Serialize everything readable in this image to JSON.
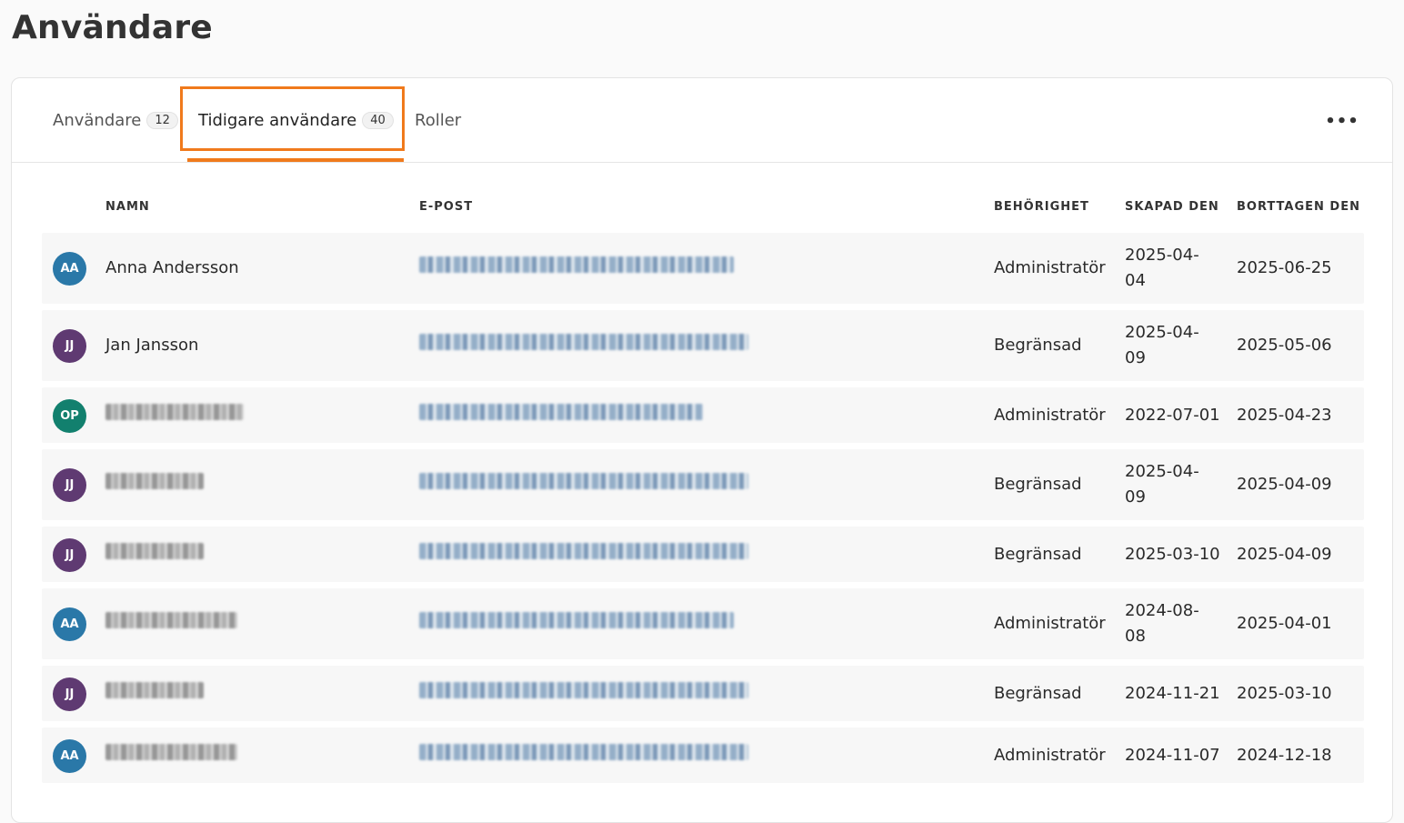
{
  "page": {
    "title": "Användare"
  },
  "tabs": [
    {
      "label": "Användare",
      "count": "12"
    },
    {
      "label": "Tidigare användare",
      "count": "40"
    },
    {
      "label": "Roller"
    }
  ],
  "more_menu": {
    "icon": "more-horizontal-icon",
    "glyph": "•••"
  },
  "table": {
    "headers": {
      "name": "NAMN",
      "email": "E-POST",
      "role": "BEHÖRIGHET",
      "created": "SKAPAD DEN",
      "deleted": "BORTTAGEN DEN"
    },
    "rows": [
      {
        "initials": "AA",
        "avatar_color": "#2a78a8",
        "name": "Anna Andersson",
        "role": "Administratör",
        "created_line1": "2025-04-",
        "created_line2": "04",
        "deleted": "2025-06-25"
      },
      {
        "initials": "JJ",
        "avatar_color": "#5f3a72",
        "name": "Jan Jansson",
        "role": "Begränsad",
        "created_line1": "2025-04-",
        "created_line2": "09",
        "deleted": "2025-05-06"
      },
      {
        "initials": "OP",
        "avatar_color": "#12806e",
        "name": "",
        "role": "Administratör",
        "created_line1": "2022-07-01",
        "created_line2": "",
        "deleted": "2025-04-23"
      },
      {
        "initials": "JJ",
        "avatar_color": "#5f3a72",
        "name": "",
        "role": "Begränsad",
        "created_line1": "2025-04-",
        "created_line2": "09",
        "deleted": "2025-04-09"
      },
      {
        "initials": "JJ",
        "avatar_color": "#5f3a72",
        "name": "",
        "role": "Begränsad",
        "created_line1": "2025-03-10",
        "created_line2": "",
        "deleted": "2025-04-09"
      },
      {
        "initials": "AA",
        "avatar_color": "#2a78a8",
        "name": "",
        "role": "Administratör",
        "created_line1": "2024-08-",
        "created_line2": "08",
        "deleted": "2025-04-01"
      },
      {
        "initials": "JJ",
        "avatar_color": "#5f3a72",
        "name": "",
        "role": "Begränsad",
        "created_line1": "2024-11-21",
        "created_line2": "",
        "deleted": "2025-03-10"
      },
      {
        "initials": "AA",
        "avatar_color": "#2a78a8",
        "name": "",
        "role": "Administratör",
        "created_line1": "2024-11-07",
        "created_line2": "",
        "deleted": "2024-12-18"
      }
    ]
  },
  "colors": {
    "accent": "#f07a1c"
  }
}
